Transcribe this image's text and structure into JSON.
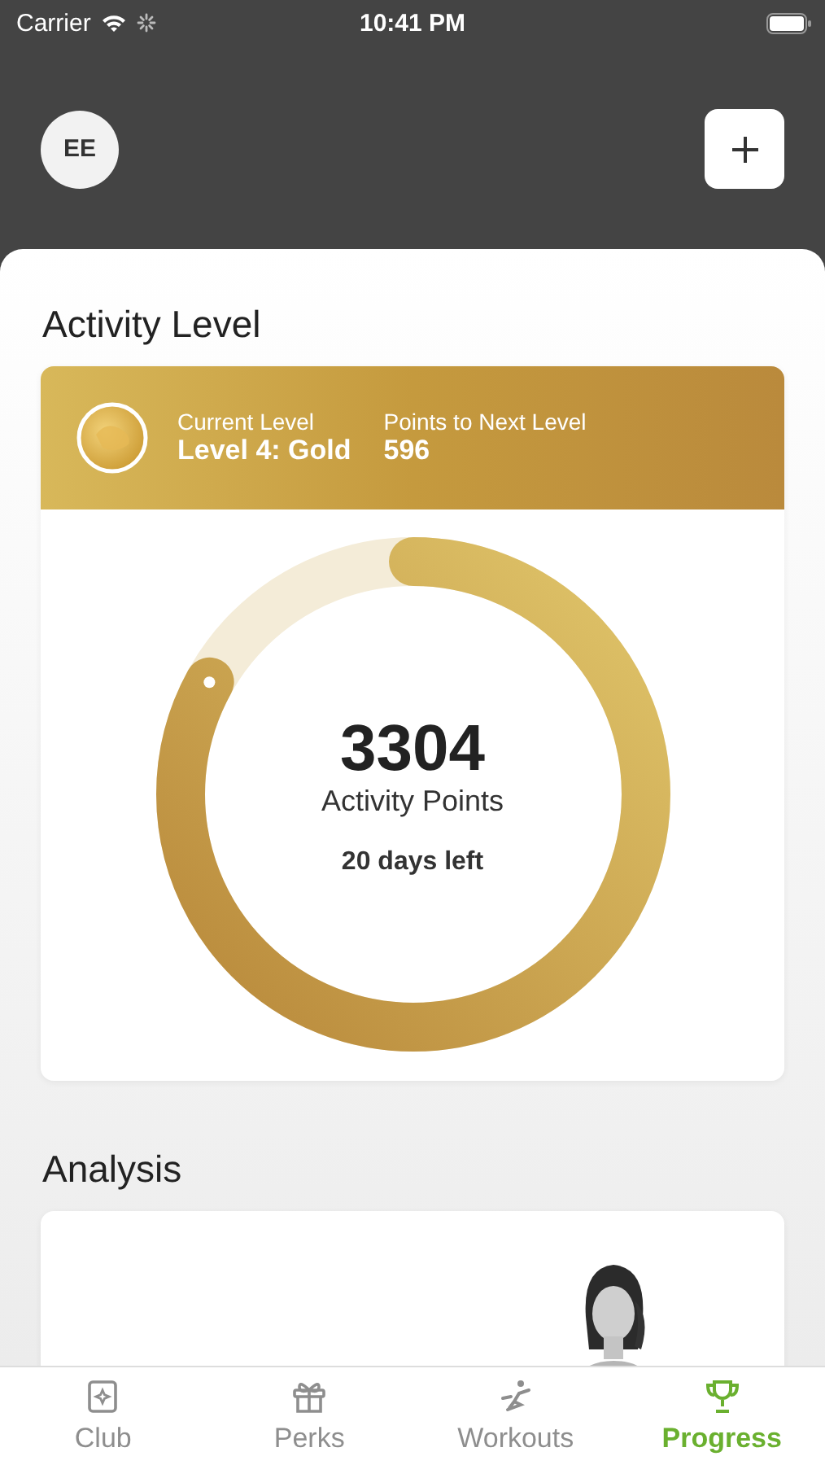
{
  "status_bar": {
    "carrier": "Carrier",
    "time": "10:41 PM"
  },
  "header": {
    "avatar_initials": "EE"
  },
  "activity": {
    "title": "Activity Level",
    "current_level_label": "Current Level",
    "current_level": "Level 4: Gold",
    "next_label": "Points to Next Level",
    "next_points": "596",
    "points": "3304",
    "points_label": "Activity Points",
    "days_left": "20 days left"
  },
  "analysis": {
    "title": "Analysis"
  },
  "tabs": [
    {
      "label": "Club",
      "selected": false
    },
    {
      "label": "Perks",
      "selected": false
    },
    {
      "label": "Workouts",
      "selected": false
    },
    {
      "label": "Progress",
      "selected": true
    }
  ]
}
